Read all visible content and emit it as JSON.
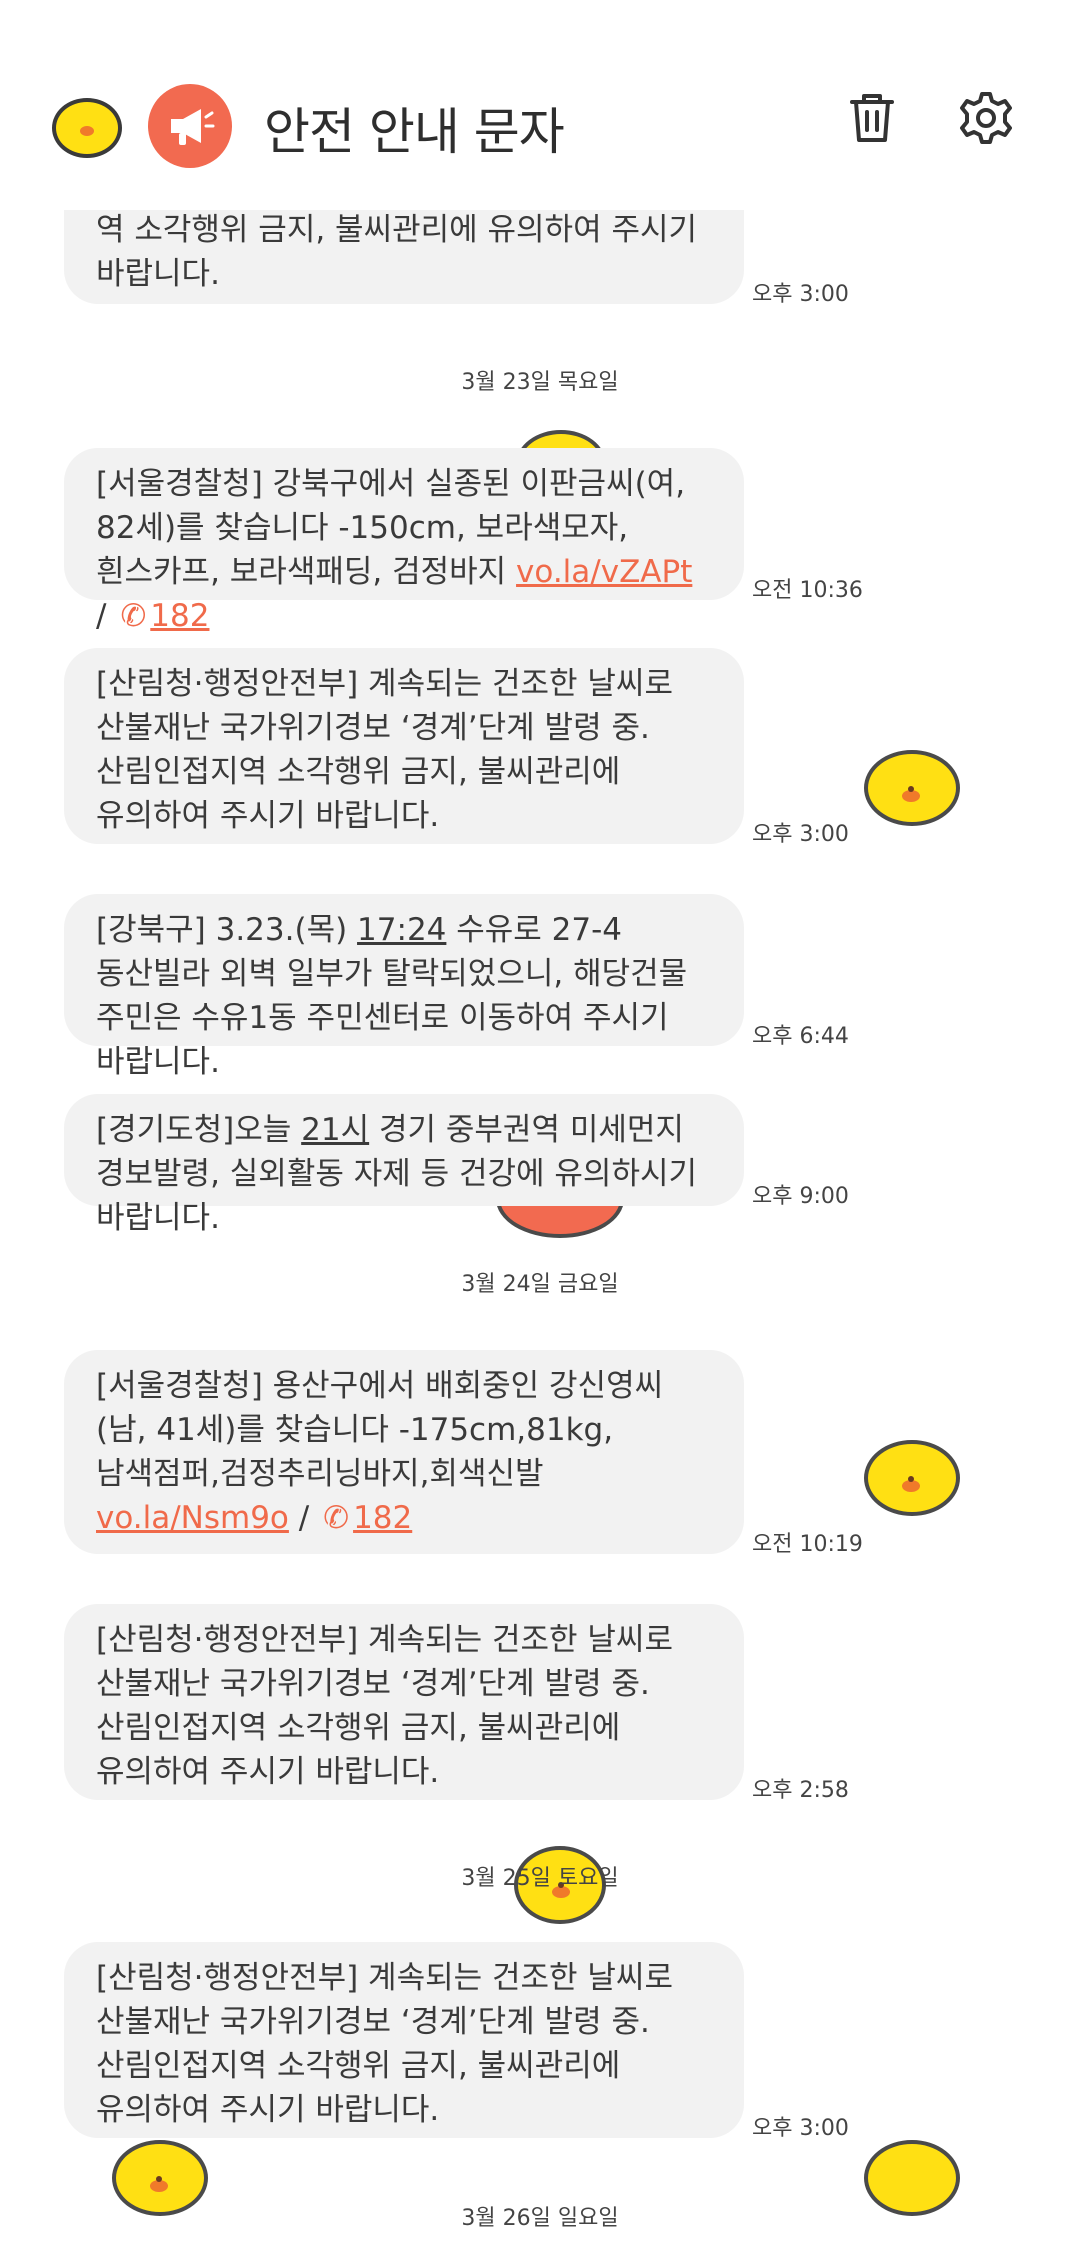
{
  "header": {
    "title": "안전 안내 문자",
    "icons": [
      "chick-avatar",
      "megaphone-icon",
      "trash-icon",
      "gear-icon"
    ]
  },
  "feed": {
    "partial_top": {
      "text": "역 소각행위 금지, 불씨관리에 유의하여 주시기 바랍니다.",
      "time": "오후 3:00"
    },
    "date1": "3월 23일 목요일",
    "msg1": {
      "text": "[서울경찰청] 강북구에서 실종된 이판금씨(여, 82세)를 찾습니다 -150cm, 보라색모자, 흰스카프, 보라색패딩, 검정바지",
      "link": "vo.la/vZAPt",
      "sep": "/",
      "phone": "182",
      "time": "오전 10:36"
    },
    "msg2": {
      "text": "[산림청·행정안전부] 계속되는 건조한 날씨로 산불재난 국가위기경보 ‘경계’단계 발령 중. 산림인접지역 소각행위 금지, 불씨관리에 유의하여 주시기 바랍니다.",
      "time": "오후 3:00"
    },
    "msg3": {
      "a": "[강북구] 3.23.(목) ",
      "b": "17:24",
      "c": " 수유로 27-4 동산빌라 외벽 일부가 탈락되었으니, 해당건물 주민은 수유1동 주민센터로 이동하여 주시기 바랍니다.",
      "time": "오후 6:44"
    },
    "msg4": {
      "a": "[경기도청]오늘 ",
      "b": "21시",
      "c": " 경기 중부권역 미세먼지 경보발령, 실외활동 자제 등 건강에 유의하시기 바랍니다.",
      "time": "오후 9:00"
    },
    "date2": "3월 24일 금요일",
    "msg5": {
      "text": "[서울경찰청] 용산구에서 배회중인 강신영씨(남, 41세)를 찾습니다 -175cm,81kg,남색점퍼,검정추리닝바지,회색신발",
      "link": "vo.la/Nsm9o",
      "sep": "/",
      "phone": "182",
      "time": "오전 10:19"
    },
    "msg6": {
      "text": "[산림청·행정안전부] 계속되는 건조한 날씨로 산불재난 국가위기경보 ‘경계’단계 발령 중. 산림인접지역 소각행위 금지, 불씨관리에 유의하여 주시기 바랍니다.",
      "time": "오후 2:58"
    },
    "date3": "3월 25일 토요일",
    "msg7": {
      "text": "[산림청·행정안전부] 계속되는 건조한 날씨로 산불재난 국가위기경보 ‘경계’단계 발령 중. 산림인접지역 소각행위 금지, 불씨관리에 유의하여 주시기 바랍니다.",
      "time": "오후 3:00"
    },
    "date4": "3월 26일 일요일"
  },
  "colors": {
    "accent": "#f26a50",
    "link": "#f06a4a",
    "bubble": "#f2f2f2",
    "chick": "#ffe013"
  }
}
